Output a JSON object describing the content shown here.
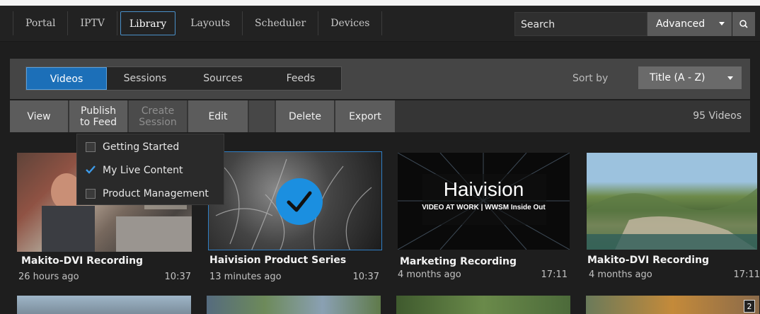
{
  "nav": {
    "items": [
      "Portal",
      "IPTV",
      "Library",
      "Layouts",
      "Scheduler",
      "Devices"
    ],
    "active": "Library",
    "search_placeholder": "Search",
    "advanced_label": "Advanced"
  },
  "library": {
    "tabs": [
      "Videos",
      "Sessions",
      "Sources",
      "Feeds"
    ],
    "active_tab": "Videos",
    "sort_label": "Sort by",
    "sort_value": "Title (A - Z)"
  },
  "toolbar": {
    "view": "View",
    "publish_line1": "Publish",
    "publish_line2": "to Feed",
    "create_line1": "Create",
    "create_line2": "Session",
    "edit": "Edit",
    "delete": "Delete",
    "export": "Export",
    "count": "95 Videos"
  },
  "feed_menu": [
    {
      "label": "Getting Started",
      "checked": false
    },
    {
      "label": "My Live Content",
      "checked": true
    },
    {
      "label": "Product Management",
      "checked": false
    }
  ],
  "videos": [
    {
      "title": "Makito-DVI Recording",
      "time": "26 hours ago",
      "duration": "10:37"
    },
    {
      "title": "Haivision Product Series",
      "time": "13 minutes ago",
      "duration": "10:37",
      "selected": true
    },
    {
      "title": "Marketing Recording",
      "time": "4 months ago",
      "duration": "17:11",
      "thumb_brand": "Haivision",
      "thumb_tagline": "VIDEO AT WORK | WWSM Inside Out"
    },
    {
      "title": "Makito-DVI Recording",
      "time": "4 months ago",
      "duration": "17:11"
    }
  ],
  "partial_badge": "2",
  "colors": {
    "accent": "#1c6fb8",
    "check": "#1b8fe0"
  }
}
